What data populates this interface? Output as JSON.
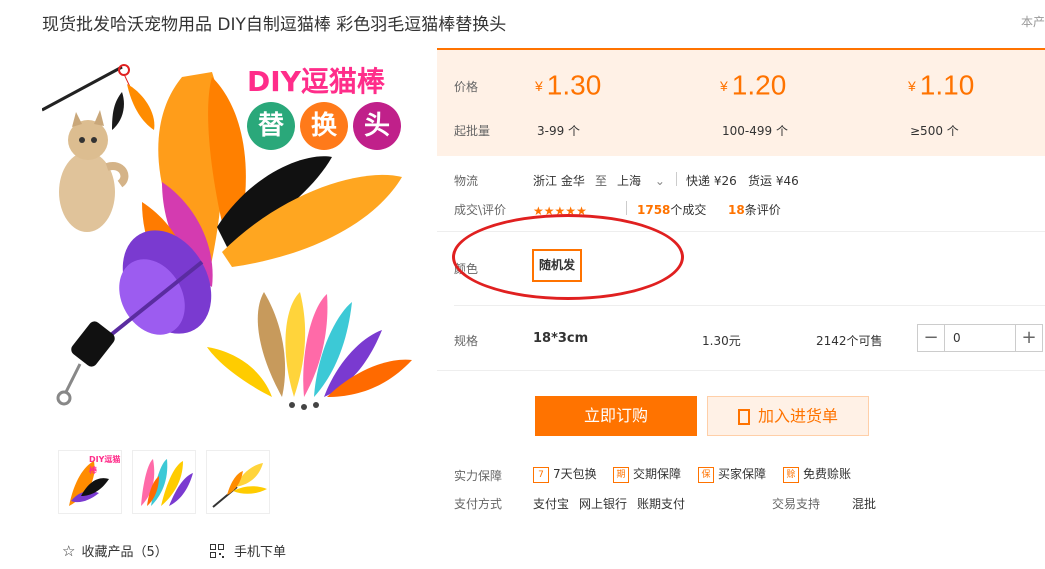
{
  "title": "现货批发哈沃宠物用品 DIY自制逗猫棒 彩色羽毛逗猫棒替换头",
  "title_extra": "本产",
  "image": {
    "banner_top": "DIY逗猫棒",
    "banner_chars": [
      "替",
      "换",
      "头"
    ],
    "thumb_text": "DIY逗猫棒"
  },
  "favorite": {
    "label": "收藏产品（5）",
    "icon": "star-outline-icon"
  },
  "mobile": {
    "label": "手机下单",
    "icon": "qr-code-icon"
  },
  "price": {
    "label": "价格",
    "tiers": [
      {
        "yen": "¥",
        "value": "1.30",
        "qty": "3-99 个"
      },
      {
        "yen": "¥",
        "value": "1.20",
        "qty": "100-499 个"
      },
      {
        "yen": "¥",
        "value": "1.10",
        "qty": "≥500 个"
      }
    ],
    "moq_label": "起批量"
  },
  "logistics": {
    "label": "物流",
    "from": "浙江 金华",
    "to_word": "至",
    "to": "上海",
    "express": "快递 ¥26",
    "freight": "货运 ¥46"
  },
  "deals": {
    "label": "成交\\评价",
    "stars": 5,
    "count": "1758",
    "count_suffix": "个成交",
    "reviews": "18",
    "reviews_suffix": "条评价"
  },
  "color": {
    "label": "颜色",
    "option": "随机发"
  },
  "spec": {
    "label": "规格",
    "value": "18*3cm",
    "price": "1.30元",
    "stock": "2142个可售",
    "qty": "0",
    "minus": "−",
    "plus": "+"
  },
  "buttons": {
    "buy": "立即订购",
    "cart": "加入进货单"
  },
  "guarantee": {
    "label": "实力保障",
    "items": [
      {
        "icon": "7-day-icon",
        "glyph": "7",
        "text": "7天包换"
      },
      {
        "icon": "delivery-icon",
        "glyph": "期",
        "text": "交期保障"
      },
      {
        "icon": "buyer-protect-icon",
        "glyph": "保",
        "text": "买家保障"
      },
      {
        "icon": "credit-icon",
        "glyph": "赊",
        "text": "免费赊账"
      }
    ]
  },
  "payment": {
    "label": "支付方式",
    "methods": [
      "支付宝",
      "网上银行",
      "账期支付"
    ],
    "trade_label": "交易支持",
    "trade_value": "混批"
  }
}
